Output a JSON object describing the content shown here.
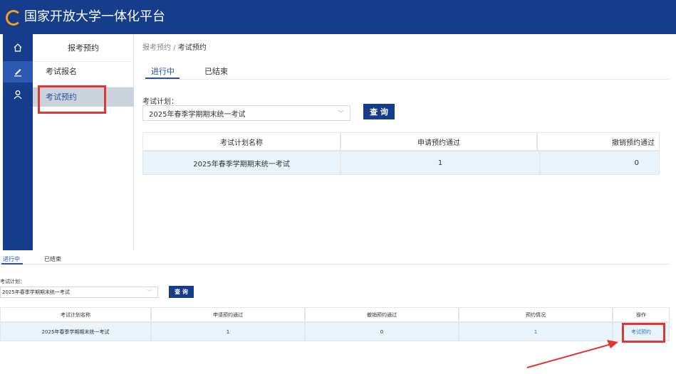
{
  "header": {
    "title": "国家开放大学一体化平台"
  },
  "leftnav": {
    "icons": [
      "home-icon",
      "pencil-icon",
      "user-icon"
    ]
  },
  "submenu": {
    "title": "报考预约",
    "items": [
      {
        "label": "考试报名"
      },
      {
        "label": "考试预约"
      }
    ]
  },
  "upper": {
    "breadcrumb": {
      "parent": "报考预约",
      "sep": "/",
      "current": "考试预约"
    },
    "tabs": [
      {
        "label": "进行中"
      },
      {
        "label": "已结束"
      }
    ],
    "plan_label": "考试计划：",
    "plan_value": "2025年春季学期期末统一考试",
    "query_label": "查 询",
    "table": {
      "headers": [
        "考试计划名称",
        "申请预约通过",
        "撤销预约通过"
      ],
      "row": [
        "2025年春季学期期末统一考试",
        "1",
        "0"
      ]
    }
  },
  "lower": {
    "tabs": [
      {
        "label": "进行中"
      },
      {
        "label": "已结束"
      }
    ],
    "plan_label": "考试计划：",
    "plan_value": "2025年春季学期期末统一考试",
    "query_label": "查 询",
    "table": {
      "headers": [
        "考试计划名称",
        "申请预约通过",
        "撤销预约通过",
        "预约情况",
        "操作"
      ],
      "row": [
        "2025年春季学期期末统一考试",
        "1",
        "0",
        "1",
        "考试预约"
      ]
    }
  },
  "colors": {
    "header": "#163c8c",
    "highlight": "#e03636",
    "link": "#2e6fd6",
    "row_bg": "#e8f3fb"
  }
}
